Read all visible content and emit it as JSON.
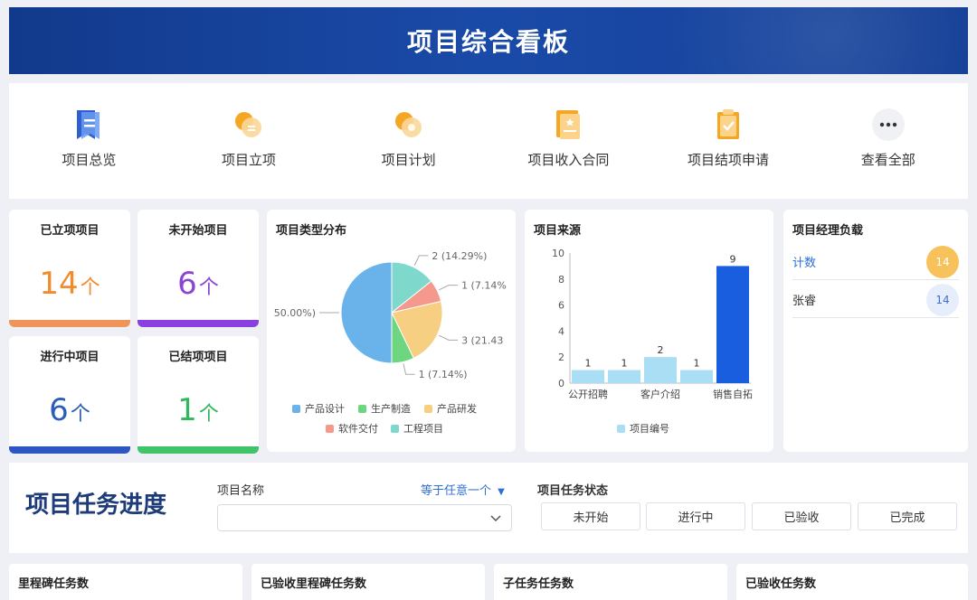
{
  "header": {
    "title": "项目综合看板"
  },
  "quick_links": [
    {
      "label": "项目总览",
      "icon": "bookmark-document-icon"
    },
    {
      "label": "项目立项",
      "icon": "project-initiation-icon"
    },
    {
      "label": "项目计划",
      "icon": "project-plan-icon"
    },
    {
      "label": "项目收入合同",
      "icon": "contract-document-icon"
    },
    {
      "label": "项目结项申请",
      "icon": "approval-check-icon"
    },
    {
      "label": "查看全部",
      "icon": "more-dots-icon"
    }
  ],
  "stats": [
    {
      "title": "已立项项目",
      "value": "14",
      "unit": "个",
      "color": "#f08c2e",
      "bar_color": "#f0955a"
    },
    {
      "title": "未开始项目",
      "value": "6",
      "unit": "个",
      "color": "#8b45d6",
      "bar_color": "#8a3fe0"
    },
    {
      "title": "进行中项目",
      "value": "6",
      "unit": "个",
      "color": "#2a5fb8",
      "bar_color": "#2e55c4"
    },
    {
      "title": "已结项项目",
      "value": "1",
      "unit": "个",
      "color": "#2fb85e",
      "bar_color": "#3fc469"
    }
  ],
  "pie_panel": {
    "title": "项目类型分布",
    "slice_labels": [
      "2 (14.29%)",
      "1 (7.14%",
      "3 (21.43",
      "1 (7.14%)",
      "50.00%)"
    ],
    "legend": [
      "产品设计",
      "生产制造",
      "产品研发",
      "软件交付",
      "工程项目"
    ]
  },
  "bar_panel": {
    "title": "项目来源",
    "legend": "项目编号"
  },
  "chart_data": [
    {
      "type": "pie",
      "title": "项目类型分布",
      "slices": [
        {
          "name": "产品设计",
          "value": 7,
          "percent": 50.0,
          "color": "#6ab3ea"
        },
        {
          "name": "生产制造",
          "value": 1,
          "percent": 7.14,
          "color": "#6ed67e"
        },
        {
          "name": "产品研发",
          "value": 3,
          "percent": 21.43,
          "color": "#f7cf82"
        },
        {
          "name": "软件交付",
          "value": 1,
          "percent": 7.14,
          "color": "#f4998c"
        },
        {
          "name": "工程项目",
          "value": 2,
          "percent": 14.29,
          "color": "#7ed8cc"
        }
      ]
    },
    {
      "type": "bar",
      "title": "项目来源",
      "series": [
        {
          "name": "项目编号",
          "values": [
            1,
            1,
            2,
            1,
            9
          ]
        }
      ],
      "x_tick_labels": [
        "公开招聘",
        "客户介绍",
        "销售自拓"
      ],
      "y_ticks": [
        0,
        2,
        4,
        6,
        8,
        10
      ],
      "ylim": [
        0,
        10
      ],
      "bar_color": "#a9def4",
      "highlight_color": "#1a5ee0"
    }
  ],
  "pm_panel": {
    "title": "项目经理负载",
    "rows": [
      {
        "name": "计数",
        "value": "14",
        "badge_bg": "#f7c25c",
        "badge_color": "#ffffff",
        "name_color": "#2f6fd6"
      },
      {
        "name": "张睿",
        "value": "14",
        "badge_bg": "#e6eefc",
        "badge_color": "#3f6fd0",
        "name_color": "#333333"
      }
    ]
  },
  "task_progress": {
    "title": "项目任务进度",
    "project_name_label": "项目名称",
    "operator_label": "等于任意一个",
    "status_label": "项目任务状态",
    "status_options": [
      "未开始",
      "进行中",
      "已验收",
      "已完成"
    ]
  },
  "bottom_cards": [
    "里程碑任务数",
    "已验收里程碑任务数",
    "子任务任务数",
    "已验收任务数"
  ]
}
